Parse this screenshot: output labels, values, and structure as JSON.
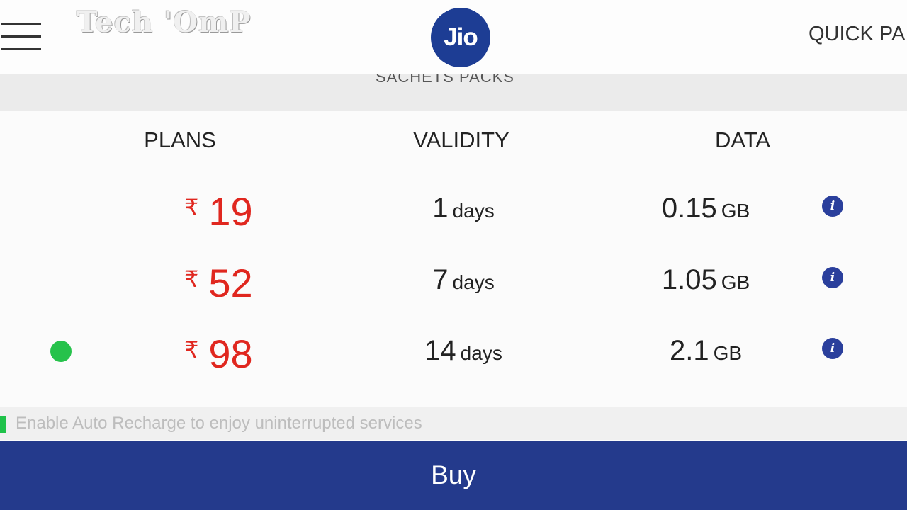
{
  "header": {
    "watermark": "Tech 'OmP",
    "logo_text": "Jio",
    "quick_pay": "QUICK PA"
  },
  "subbar": {
    "label": "SACHETS PACKS"
  },
  "columns": {
    "plans": "PLANS",
    "validity": "VALIDITY",
    "data": "DATA"
  },
  "plans": [
    {
      "currency": "₹",
      "amount": "19",
      "validity_value": "1",
      "validity_unit": "days",
      "data_value": "0.15",
      "data_unit": "GB",
      "selected": false
    },
    {
      "currency": "₹",
      "amount": "52",
      "validity_value": "7",
      "validity_unit": "days",
      "data_value": "1.05",
      "data_unit": "GB",
      "selected": false
    },
    {
      "currency": "₹",
      "amount": "98",
      "validity_value": "14",
      "validity_unit": "days",
      "data_value": "2.1",
      "data_unit": "GB",
      "selected": true
    }
  ],
  "auto_recharge": {
    "text": "Enable Auto Recharge to enjoy uninterrupted services"
  },
  "buy": {
    "label": "Buy"
  },
  "icons": {
    "menu": "hamburger-menu-icon",
    "info": "info-icon",
    "selected": "radio-selected-icon"
  },
  "colors": {
    "brand": "#1d3d94",
    "buy_bar": "#243a8c",
    "price": "#e0271f",
    "selected": "#26c24b"
  }
}
